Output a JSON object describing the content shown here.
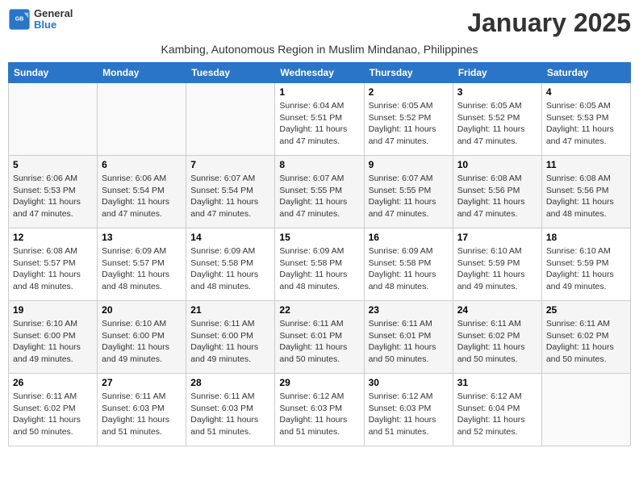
{
  "header": {
    "logo_line1": "General",
    "logo_line2": "Blue",
    "title": "January 2025",
    "subtitle": "Kambing, Autonomous Region in Muslim Mindanao, Philippines"
  },
  "weekdays": [
    "Sunday",
    "Monday",
    "Tuesday",
    "Wednesday",
    "Thursday",
    "Friday",
    "Saturday"
  ],
  "weeks": [
    [
      {
        "day": "",
        "info": ""
      },
      {
        "day": "",
        "info": ""
      },
      {
        "day": "",
        "info": ""
      },
      {
        "day": "1",
        "info": "Sunrise: 6:04 AM\nSunset: 5:51 PM\nDaylight: 11 hours and 47 minutes."
      },
      {
        "day": "2",
        "info": "Sunrise: 6:05 AM\nSunset: 5:52 PM\nDaylight: 11 hours and 47 minutes."
      },
      {
        "day": "3",
        "info": "Sunrise: 6:05 AM\nSunset: 5:52 PM\nDaylight: 11 hours and 47 minutes."
      },
      {
        "day": "4",
        "info": "Sunrise: 6:05 AM\nSunset: 5:53 PM\nDaylight: 11 hours and 47 minutes."
      }
    ],
    [
      {
        "day": "5",
        "info": "Sunrise: 6:06 AM\nSunset: 5:53 PM\nDaylight: 11 hours and 47 minutes."
      },
      {
        "day": "6",
        "info": "Sunrise: 6:06 AM\nSunset: 5:54 PM\nDaylight: 11 hours and 47 minutes."
      },
      {
        "day": "7",
        "info": "Sunrise: 6:07 AM\nSunset: 5:54 PM\nDaylight: 11 hours and 47 minutes."
      },
      {
        "day": "8",
        "info": "Sunrise: 6:07 AM\nSunset: 5:55 PM\nDaylight: 11 hours and 47 minutes."
      },
      {
        "day": "9",
        "info": "Sunrise: 6:07 AM\nSunset: 5:55 PM\nDaylight: 11 hours and 47 minutes."
      },
      {
        "day": "10",
        "info": "Sunrise: 6:08 AM\nSunset: 5:56 PM\nDaylight: 11 hours and 47 minutes."
      },
      {
        "day": "11",
        "info": "Sunrise: 6:08 AM\nSunset: 5:56 PM\nDaylight: 11 hours and 48 minutes."
      }
    ],
    [
      {
        "day": "12",
        "info": "Sunrise: 6:08 AM\nSunset: 5:57 PM\nDaylight: 11 hours and 48 minutes."
      },
      {
        "day": "13",
        "info": "Sunrise: 6:09 AM\nSunset: 5:57 PM\nDaylight: 11 hours and 48 minutes."
      },
      {
        "day": "14",
        "info": "Sunrise: 6:09 AM\nSunset: 5:58 PM\nDaylight: 11 hours and 48 minutes."
      },
      {
        "day": "15",
        "info": "Sunrise: 6:09 AM\nSunset: 5:58 PM\nDaylight: 11 hours and 48 minutes."
      },
      {
        "day": "16",
        "info": "Sunrise: 6:09 AM\nSunset: 5:58 PM\nDaylight: 11 hours and 48 minutes."
      },
      {
        "day": "17",
        "info": "Sunrise: 6:10 AM\nSunset: 5:59 PM\nDaylight: 11 hours and 49 minutes."
      },
      {
        "day": "18",
        "info": "Sunrise: 6:10 AM\nSunset: 5:59 PM\nDaylight: 11 hours and 49 minutes."
      }
    ],
    [
      {
        "day": "19",
        "info": "Sunrise: 6:10 AM\nSunset: 6:00 PM\nDaylight: 11 hours and 49 minutes."
      },
      {
        "day": "20",
        "info": "Sunrise: 6:10 AM\nSunset: 6:00 PM\nDaylight: 11 hours and 49 minutes."
      },
      {
        "day": "21",
        "info": "Sunrise: 6:11 AM\nSunset: 6:00 PM\nDaylight: 11 hours and 49 minutes."
      },
      {
        "day": "22",
        "info": "Sunrise: 6:11 AM\nSunset: 6:01 PM\nDaylight: 11 hours and 50 minutes."
      },
      {
        "day": "23",
        "info": "Sunrise: 6:11 AM\nSunset: 6:01 PM\nDaylight: 11 hours and 50 minutes."
      },
      {
        "day": "24",
        "info": "Sunrise: 6:11 AM\nSunset: 6:02 PM\nDaylight: 11 hours and 50 minutes."
      },
      {
        "day": "25",
        "info": "Sunrise: 6:11 AM\nSunset: 6:02 PM\nDaylight: 11 hours and 50 minutes."
      }
    ],
    [
      {
        "day": "26",
        "info": "Sunrise: 6:11 AM\nSunset: 6:02 PM\nDaylight: 11 hours and 50 minutes."
      },
      {
        "day": "27",
        "info": "Sunrise: 6:11 AM\nSunset: 6:03 PM\nDaylight: 11 hours and 51 minutes."
      },
      {
        "day": "28",
        "info": "Sunrise: 6:11 AM\nSunset: 6:03 PM\nDaylight: 11 hours and 51 minutes."
      },
      {
        "day": "29",
        "info": "Sunrise: 6:12 AM\nSunset: 6:03 PM\nDaylight: 11 hours and 51 minutes."
      },
      {
        "day": "30",
        "info": "Sunrise: 6:12 AM\nSunset: 6:03 PM\nDaylight: 11 hours and 51 minutes."
      },
      {
        "day": "31",
        "info": "Sunrise: 6:12 AM\nSunset: 6:04 PM\nDaylight: 11 hours and 52 minutes."
      },
      {
        "day": "",
        "info": ""
      }
    ]
  ]
}
